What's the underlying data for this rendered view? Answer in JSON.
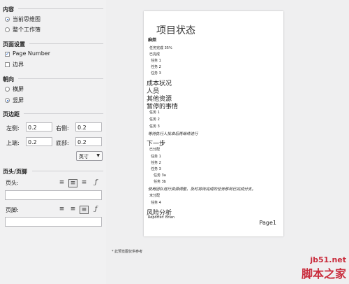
{
  "sidebar": {
    "content_section": {
      "title": "内容",
      "options": [
        "当前思维图",
        "整个工作簿"
      ],
      "selected": 0
    },
    "page_settings": {
      "title": "页面设置",
      "page_number": "Page Number",
      "page_number_checked": true,
      "border": "边界",
      "border_checked": false
    },
    "orientation": {
      "title": "朝向",
      "options": [
        "横屏",
        "竖屏"
      ],
      "selected": 1
    },
    "margins": {
      "title": "页边距",
      "left_label": "左侧:",
      "left_value": "0.2",
      "right_label": "右侧:",
      "right_value": "0.2",
      "top_label": "上端:",
      "top_value": "0.2",
      "bottom_label": "底部:",
      "bottom_value": "0.2",
      "unit": "英寸"
    },
    "header_footer": {
      "title": "页头/页脚",
      "header_label": "页头:",
      "footer_label": "页脚:",
      "header_align": "center",
      "footer_align": "right"
    }
  },
  "preview": {
    "title": "项目状态",
    "lines": [
      {
        "t": "麻烦",
        "c": "h2"
      },
      {
        "t": "任务完成 35%",
        "c": "s"
      },
      {
        "t": "已完成",
        "c": "s"
      },
      {
        "t": "任务 1",
        "c": "s"
      },
      {
        "t": "任务 2",
        "c": "s"
      },
      {
        "t": "任务 3",
        "c": "s"
      },
      {
        "t": "成本状况",
        "c": "h1"
      },
      {
        "t": "人员",
        "c": "h1"
      },
      {
        "t": "其他资源",
        "c": "h1"
      },
      {
        "t": "暂停的事情",
        "c": "h1"
      },
      {
        "t": "任务 1",
        "c": "s"
      },
      {
        "t": "任务 2",
        "c": "s"
      },
      {
        "t": "任务 3",
        "c": "s"
      },
      {
        "t": "等待执行人批准后再继续进行",
        "c": "it"
      },
      {
        "t": "下一步",
        "c": "h1"
      },
      {
        "t": "已分配",
        "c": "s"
      },
      {
        "t": "任务 1",
        "c": "s"
      },
      {
        "t": "任务 2",
        "c": "s"
      },
      {
        "t": "任务 3",
        "c": "s"
      },
      {
        "t": "任务 3a",
        "c": "s"
      },
      {
        "t": "任务 3b",
        "c": "s"
      },
      {
        "t": "使用团队进行资源调整，及时将待完成的任务移到已完成分支。",
        "c": "it"
      },
      {
        "t": "未分配",
        "c": "s"
      },
      {
        "t": "任务 4",
        "c": "s"
      },
      {
        "t": "风险分析",
        "c": "h1"
      },
      {
        "t": "Reporter: Brian",
        "c": "s"
      }
    ],
    "page_label": "Page1"
  },
  "footnote": "* 此预览图仅供参考",
  "watermark": {
    "line1": "jb51.net",
    "line2": "脚本之家"
  }
}
